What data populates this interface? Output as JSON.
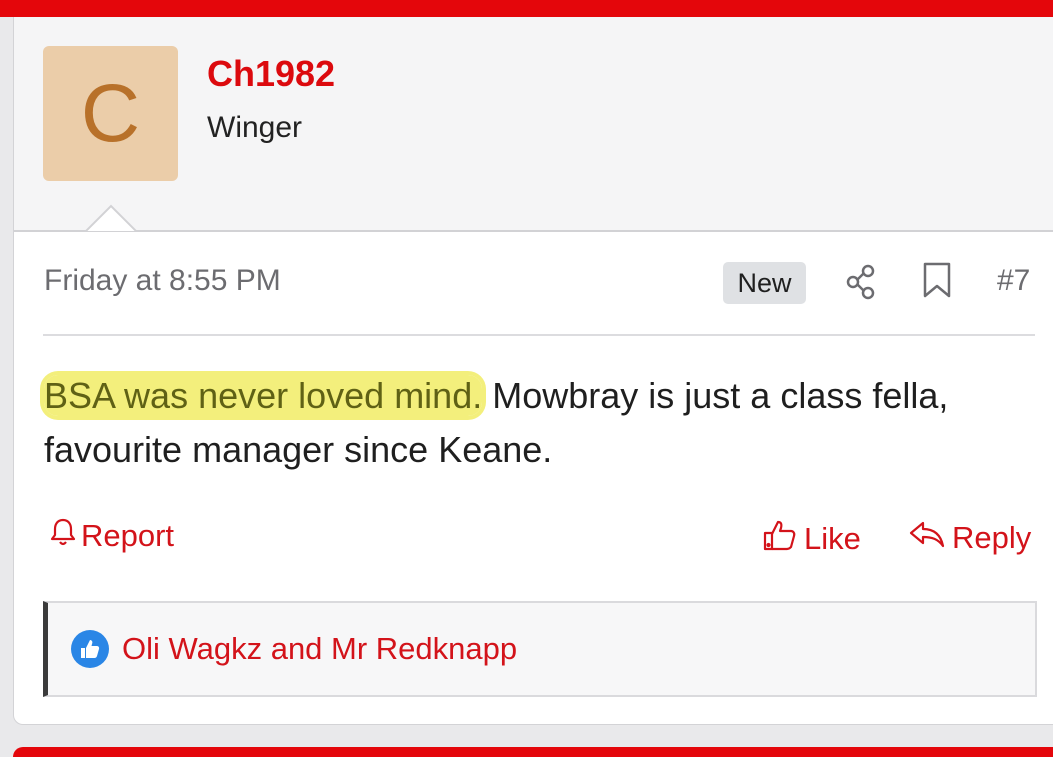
{
  "post": {
    "author": {
      "avatar_letter": "C",
      "avatar_bg": "#ebcda9",
      "name": "Ch1982",
      "title": "Winger"
    },
    "meta": {
      "date": "Friday at 8:55 PM",
      "badge": "New",
      "post_number": "#7",
      "icons": [
        "share-icon",
        "bookmark-icon"
      ]
    },
    "body": {
      "highlighted": "BSA was never loved mind.",
      "rest": " Mowbray is just a class fella, favourite manager since Keane."
    },
    "actions": {
      "report": "Report",
      "like": "Like",
      "reply": "Reply"
    },
    "reactions": {
      "icon": "thumbs-up-icon",
      "names": "Oli Wagkz and Mr Redknapp"
    }
  },
  "colors": {
    "accent": "#e4060b",
    "link": "#d3131a",
    "highlight": "#f3ef7c"
  }
}
